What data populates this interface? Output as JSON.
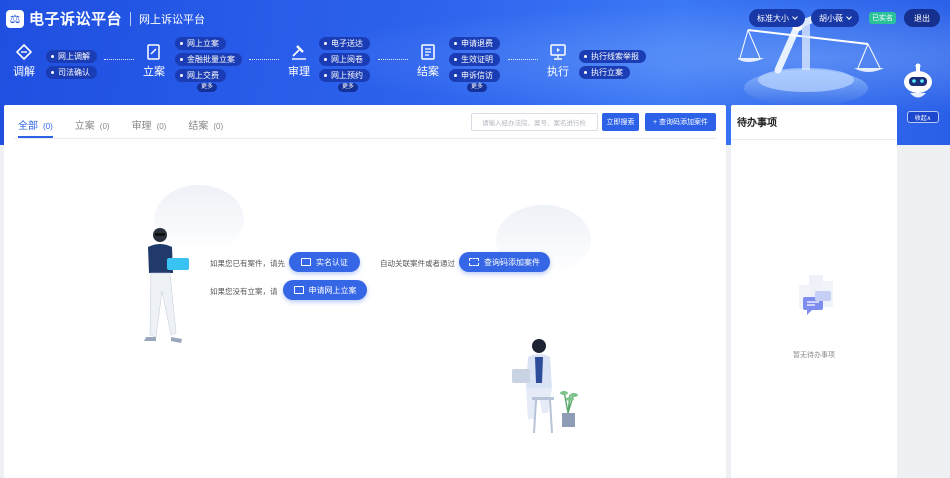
{
  "header": {
    "logo_mark": "⚖",
    "app_title": "电子诉讼平台",
    "subtitle": "网上诉讼平台",
    "font_size_label": "标准大小",
    "user_name": "胡小薇",
    "verified_badge": "已实名",
    "logout_label": "退出",
    "collapse_label": "收起∧"
  },
  "flow": {
    "stages": [
      {
        "label": "调解",
        "icon": "diamond-icon",
        "chips": [
          "网上调解",
          "司法确认"
        ],
        "more": ""
      },
      {
        "label": "立案",
        "icon": "file-edit-icon",
        "chips": [
          "网上立案",
          "金融批量立案",
          "网上交费"
        ],
        "more": "更多"
      },
      {
        "label": "审理",
        "icon": "gavel-icon",
        "chips": [
          "电子送达",
          "网上阅卷",
          "网上预约"
        ],
        "more": "更多"
      },
      {
        "label": "结案",
        "icon": "document-icon",
        "chips": [
          "申请退费",
          "生效证明",
          "申诉信访"
        ],
        "more": "更多"
      },
      {
        "label": "执行",
        "icon": "monitor-icon",
        "chips": [
          "执行线索举报",
          "执行立案"
        ],
        "more": ""
      }
    ]
  },
  "main": {
    "tabs": [
      {
        "label": "全部",
        "count": "(0)"
      },
      {
        "label": "立案",
        "count": "(0)"
      },
      {
        "label": "审理",
        "count": "(0)"
      },
      {
        "label": "结案",
        "count": "(0)"
      }
    ],
    "search_placeholder": "请输入经办法院、案号、案名进行检",
    "search_button": "立即搜索",
    "add_case_button": "+ 查询码添加案件",
    "hint_has_case": "如果您已有案件，请先",
    "hint_link_case": "自动关联案件或者通过",
    "hint_no_case": "如果您没有立案，请",
    "cta_real_name": "实名认证",
    "cta_query_code": "查询码添加案件",
    "cta_file_online": "申请网上立案"
  },
  "todo": {
    "title": "待办事项",
    "empty_text": "暂无待办事项"
  },
  "colors": {
    "primary": "#2d62e8",
    "banner": "#2455e2",
    "verified": "#2bc29a"
  }
}
